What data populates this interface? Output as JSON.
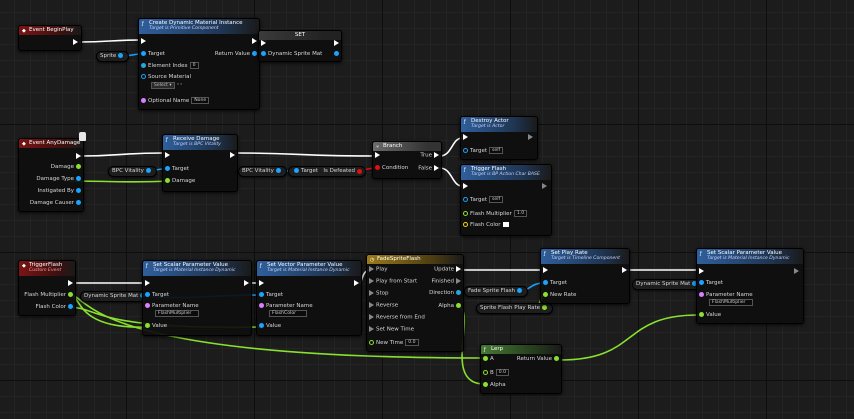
{
  "begin_play": {
    "title": "Event BeginPlay"
  },
  "create_dmi": {
    "title": "Create Dynamic Material Instance",
    "subtitle": "Target is Primitive Component",
    "return_label": "Return Value",
    "element_index_label": "Element Index",
    "element_index_value": "0",
    "source_material_label": "Source Material",
    "source_material_value": "Select",
    "optional_name_label": "Optional Name",
    "optional_name_value": "None"
  },
  "sprite_var": {
    "label": "Sprite"
  },
  "set_node": {
    "title": "SET",
    "pin_label": "Dynamic Sprite Mat"
  },
  "any_damage": {
    "title": "Event AnyDamage",
    "pins": [
      "Damage",
      "Damage Type",
      "Instigated By",
      "Damage Causer"
    ]
  },
  "receive_damage": {
    "title": "Receive Damage",
    "subtitle": "Target is BPC Vitality",
    "target_label": "Target",
    "damage_label": "Damage"
  },
  "bpc_vitality_1": {
    "label": "BPC Vitality"
  },
  "bpc_vitality_2": {
    "label": "BPC Vitality"
  },
  "is_defeated": {
    "target_label": "Target",
    "label": "Is Defeated"
  },
  "branch": {
    "title": "Branch",
    "condition_label": "Condition",
    "true_label": "True",
    "false_label": "False"
  },
  "destroy_actor": {
    "title": "Destroy Actor",
    "subtitle": "Target is Actor",
    "target_label": "Target",
    "target_value": "self"
  },
  "trigger_flash_call": {
    "title": "Trigger Flash",
    "subtitle": "Target is BP Action Char BASE",
    "target_label": "Target",
    "target_value": "self",
    "flash_multiplier_label": "Flash Multiplier",
    "flash_multiplier_value": "1.0",
    "flash_color_label": "Flash Color"
  },
  "trigger_flash_event": {
    "title": "TriggerFlash",
    "subtitle": "Custom Event",
    "flash_multiplier_label": "Flash Multiplier",
    "flash_color_label": "Flash Color"
  },
  "dsm_var_1": {
    "label": "Dynamic Sprite Mat"
  },
  "dsm_var_2": {
    "label": "Dynamic Sprite Mat"
  },
  "set_scalar_1": {
    "title": "Set Scalar Parameter Value",
    "subtitle": "Target is Material Instance Dynamic",
    "target_label": "Target",
    "param_label": "Parameter Name",
    "param_value": "FlashMultiplier",
    "value_label": "Value"
  },
  "set_vector": {
    "title": "Set Vector Parameter Value",
    "subtitle": "Target is Material Instance Dynamic",
    "target_label": "Target",
    "param_label": "Parameter Name",
    "param_value": "FlashColor",
    "value_label": "Value"
  },
  "timeline": {
    "title": "FadeSpriteFlash",
    "inputs": [
      "Play",
      "Play from Start",
      "Stop",
      "Reverse",
      "Reverse from End",
      "Set New Time"
    ],
    "new_time_label": "New Time",
    "new_time_value": "0.0",
    "outputs": [
      "Update",
      "Finished",
      "Direction",
      "Alpha"
    ]
  },
  "fade_flash_var": {
    "label": "Fade Sprite Flash"
  },
  "fade_rate_var": {
    "label": "Sprite Flash Play Rate"
  },
  "set_play_rate": {
    "title": "Set Play Rate",
    "subtitle": "Target is Timeline Component",
    "target_label": "Target",
    "rate_label": "New Rate"
  },
  "set_scalar_2": {
    "title": "Set Scalar Parameter Value",
    "subtitle": "Target is Material Instance Dynamic",
    "target_label": "Target",
    "param_label": "Parameter Name",
    "param_value": "FlashMultiplier",
    "value_label": "Value"
  },
  "lerp": {
    "title": "Lerp",
    "a_label": "A",
    "b_label": "B",
    "b_value": "0.0",
    "alpha_label": "Alpha",
    "return_label": "Return Value"
  },
  "colors": {
    "exec": "#ffffff",
    "object": "#1aa3ff",
    "float": "#8ae02e",
    "bool": "#d11111",
    "event": "#7a1414",
    "function": "#2f5f9c",
    "timeline": "#9c7a1a"
  }
}
